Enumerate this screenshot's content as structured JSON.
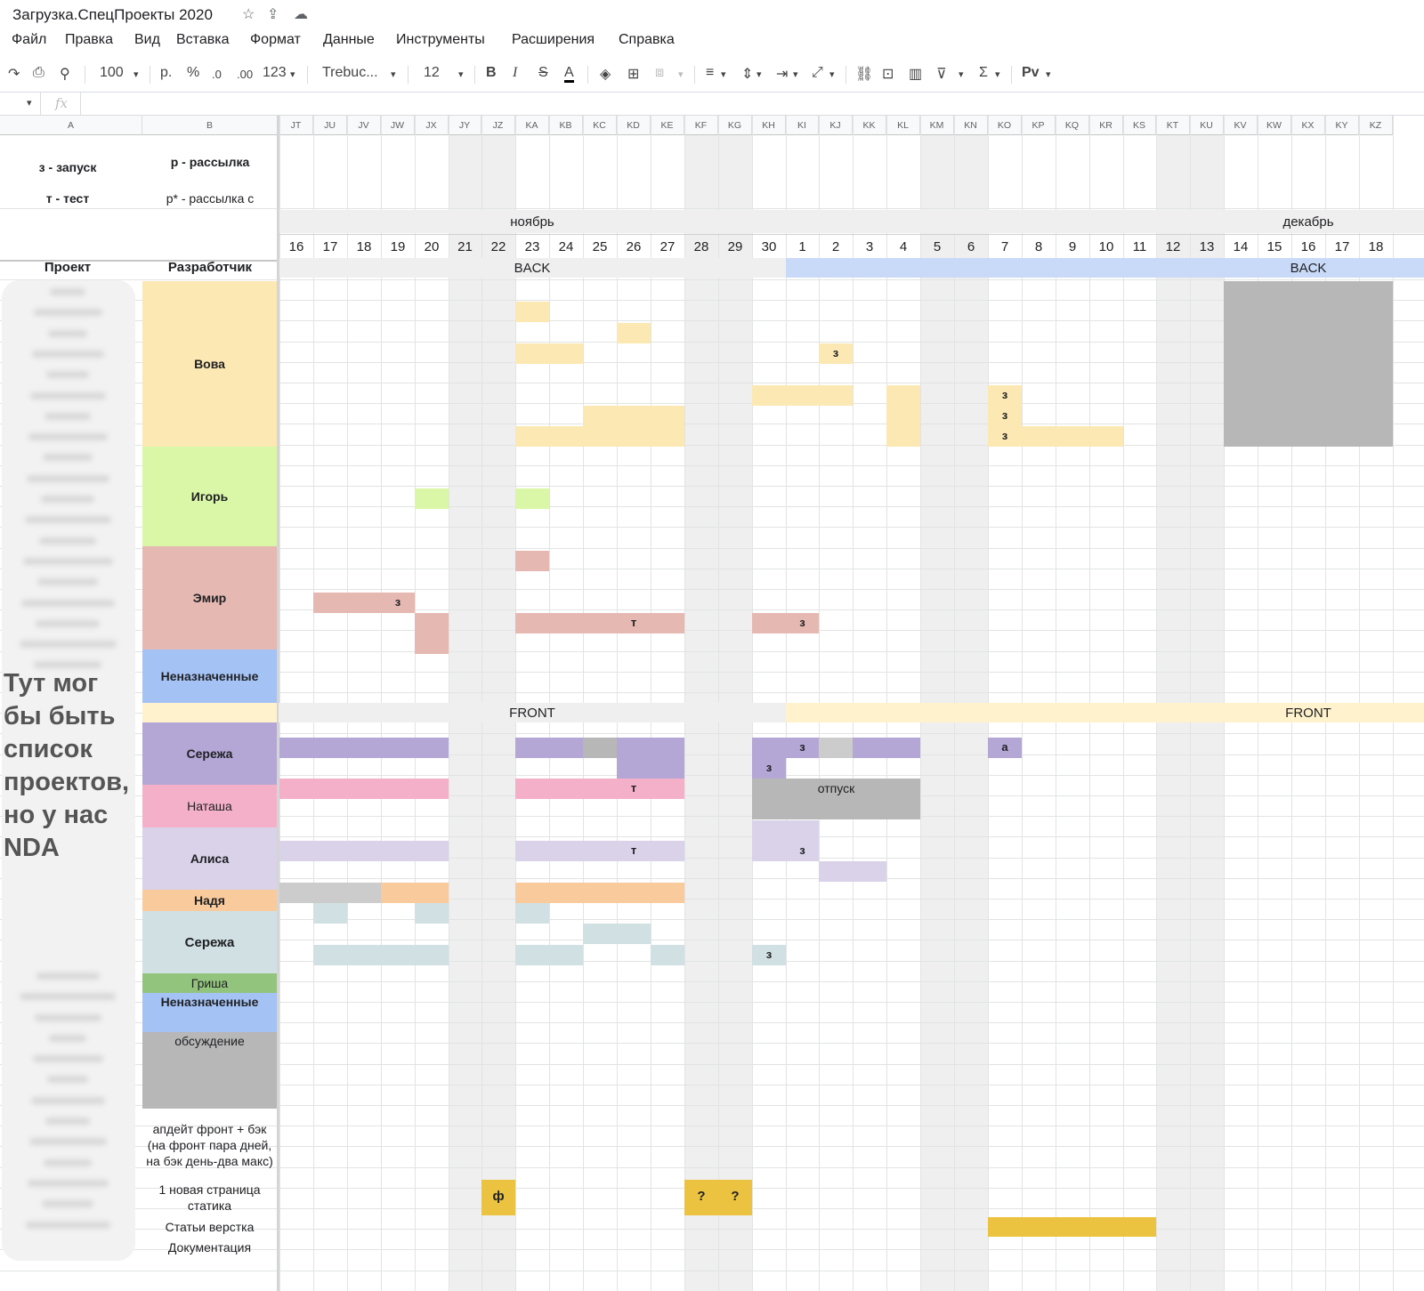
{
  "window": {
    "title": "Загрузка.СпецПроекты 2020",
    "icons": [
      "star-icon",
      "move-to-drive-icon",
      "cloud-status-icon"
    ]
  },
  "menu": [
    "Файл",
    "Правка",
    "Вид",
    "Вставка",
    "Формат",
    "Данные",
    "Инструменты",
    "Расширения",
    "Справка"
  ],
  "toolbar": {
    "zoom": "100",
    "currency": "р.",
    "percent": "%",
    "decimal_dec": ".0",
    "decimal_inc": ".00",
    "number_format": "123",
    "font": "Trebuc...",
    "font_size": "12",
    "bold": "B",
    "italic": "I",
    "strike": "S",
    "text_color": "A",
    "sum": "Σ",
    "input_tool": "Pv"
  },
  "formula_bar": {
    "fx": "fx"
  },
  "columns": {
    "left": [
      "A",
      "B"
    ],
    "days": [
      "JT",
      "JU",
      "JV",
      "JW",
      "JX",
      "JY",
      "JZ",
      "KA",
      "KB",
      "KC",
      "KD",
      "KE",
      "KF",
      "KG",
      "KH",
      "KI",
      "KJ",
      "KK",
      "KL",
      "KM",
      "KN",
      "KO",
      "KP",
      "KQ",
      "KR",
      "KS",
      "KT",
      "KU",
      "KV",
      "KW",
      "KX",
      "KY",
      "KZ"
    ]
  },
  "legend": {
    "launch": "з - запуск",
    "test": "т - тест",
    "mailing": "р - рассылка",
    "mailing_star": "р* - рассылка с"
  },
  "months": {
    "november": "ноябрь",
    "december": "декабрь"
  },
  "dates": [
    "16",
    "17",
    "18",
    "19",
    "20",
    "21",
    "22",
    "23",
    "24",
    "25",
    "26",
    "27",
    "28",
    "29",
    "30",
    "1",
    "2",
    "3",
    "4",
    "5",
    "6",
    "7",
    "8",
    "9",
    "10",
    "11",
    "12",
    "13",
    "14",
    "15",
    "16",
    "17",
    "18"
  ],
  "headers": {
    "project": "Проект",
    "developer": "Разработчик"
  },
  "sections": {
    "back": "BACK",
    "front": "FRONT"
  },
  "developers": {
    "vova": "Вова",
    "igor": "Игорь",
    "emir": "Эмир",
    "unassigned_back": "Неназначенные",
    "serezha": "Сережа",
    "natasha": "Наташа",
    "alisa": "Алиса",
    "nadya": "Надя",
    "serezha2": "Сережа",
    "grisha": "Гриша",
    "unassigned_front": "Неназначенные",
    "discussion": "обсуждение"
  },
  "notes": {
    "update": "апдейт фронт + бэк (на фронт пара дней, на бэк день-два макс)",
    "new_page": "1 новая страница статика",
    "articles": "Статьи верстка",
    "docs": "Документация"
  },
  "nda_note": "Тут мог бы быть список проектов, но у нас NDA",
  "cell_marks": {
    "launch": "з",
    "test": "т",
    "a": "а",
    "f": "ф",
    "question": "?",
    "vacation": "отпуск"
  },
  "colors": {
    "vova": "#fce8b2",
    "igor": "#d9f7a6",
    "emir": "#e6b8b2",
    "unassigned": "#a4c2f4",
    "serezha": "#b4a7d6",
    "natasha": "#f4b0c8",
    "alisa": "#d9d2e9",
    "nadya": "#f9cb9c",
    "serezha2": "#d0e0e3",
    "grisha": "#93c47d",
    "discussion": "#b7b7b7",
    "weekend": "#efefef",
    "back_band": "#c9daf8",
    "front_band": "#fff2cc",
    "gold": "#ecc340"
  }
}
